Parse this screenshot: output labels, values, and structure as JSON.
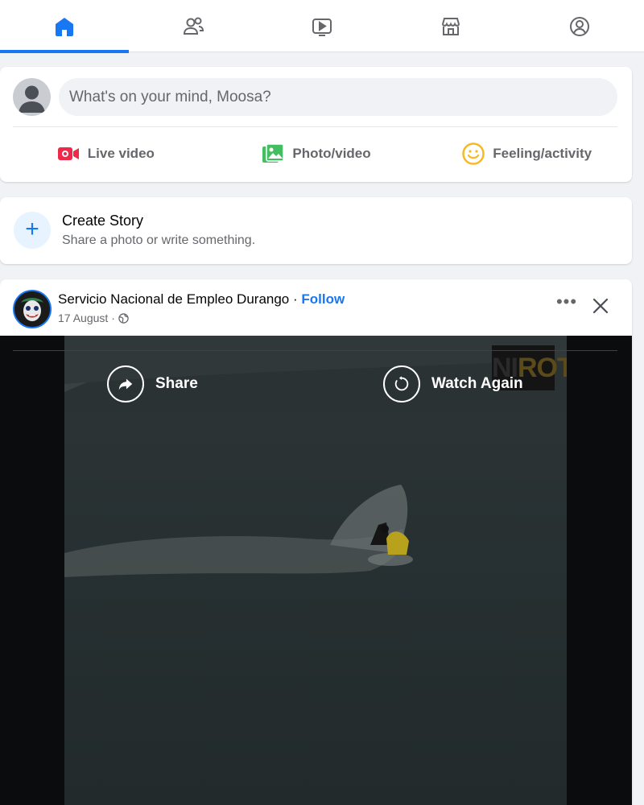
{
  "nav": {
    "tabs": [
      {
        "name": "home",
        "icon": "home-icon",
        "active": true
      },
      {
        "name": "friends",
        "icon": "friends-icon",
        "active": false
      },
      {
        "name": "watch",
        "icon": "video-icon",
        "active": false
      },
      {
        "name": "marketplace",
        "icon": "marketplace-icon",
        "active": false
      },
      {
        "name": "profile",
        "icon": "profile-icon",
        "active": false
      }
    ],
    "accent": "#1877f2"
  },
  "composer": {
    "placeholder": "What's on your mind, Moosa?",
    "actions": [
      {
        "label": "Live video",
        "icon": "live-video-icon",
        "color": "#f02849"
      },
      {
        "label": "Photo/video",
        "icon": "photo-icon",
        "color": "#45bd62"
      },
      {
        "label": "Feeling/activity",
        "icon": "feeling-icon",
        "color": "#f7b928"
      }
    ]
  },
  "story": {
    "title": "Create Story",
    "subtitle": "Share a photo or write something."
  },
  "post": {
    "author": "Servicio Nacional de Empleo Durango",
    "separator": " · ",
    "follow": "Follow",
    "date": "17 August",
    "meta_separator": " · ",
    "privacy_icon": "globe-icon",
    "more": "•••",
    "video": {
      "share_label": "Share",
      "watch_again_label": "Watch Again",
      "watermark_left": "NI",
      "watermark_right": "ROT"
    }
  }
}
